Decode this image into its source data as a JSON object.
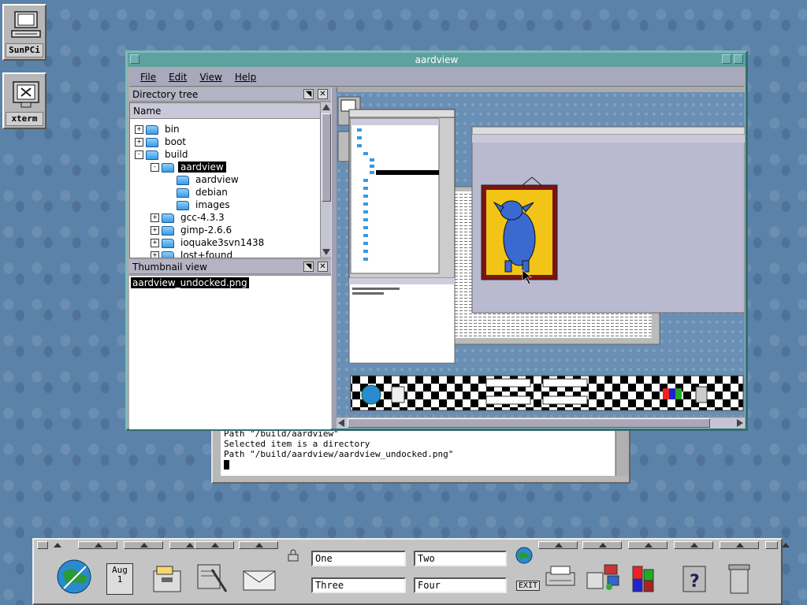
{
  "desktop": {
    "icons": [
      {
        "label": "SunPCi",
        "icon": "computer-icon"
      },
      {
        "label": "xterm",
        "icon": "terminal-icon"
      }
    ]
  },
  "xterm": {
    "lines": [
      "Path \"/build/aardview\"",
      "Selected item is a directory",
      "Path \"/build/aardview/aardview_undocked.png\""
    ]
  },
  "window": {
    "title": "aardview",
    "menu": [
      "File",
      "Edit",
      "View",
      "Help"
    ],
    "directory_panel": {
      "title": "Directory tree",
      "column": "Name",
      "rows": [
        {
          "label": "bin",
          "expander": "+",
          "depth": 0
        },
        {
          "label": "boot",
          "expander": "+",
          "depth": 0
        },
        {
          "label": "build",
          "expander": "-",
          "depth": 0
        },
        {
          "label": "aardview",
          "expander": "-",
          "depth": 1,
          "selected": true
        },
        {
          "label": "aardview",
          "expander": "",
          "depth": 2
        },
        {
          "label": "debian",
          "expander": "",
          "depth": 2
        },
        {
          "label": "images",
          "expander": "",
          "depth": 2
        },
        {
          "label": "gcc-4.3.3",
          "expander": "+",
          "depth": 1
        },
        {
          "label": "gimp-2.6.6",
          "expander": "+",
          "depth": 1
        },
        {
          "label": "ioquake3svn1438",
          "expander": "+",
          "depth": 1
        },
        {
          "label": "lost+found",
          "expander": "+",
          "depth": 1
        }
      ]
    },
    "thumbnail_panel": {
      "title": "Thumbnail view",
      "items": [
        "aardview_undocked.png"
      ]
    }
  },
  "front_panel": {
    "date": {
      "month": "Aug",
      "day": "1"
    },
    "workspaces": [
      "One",
      "Two",
      "Three",
      "Four"
    ],
    "exit_label": "EXIT",
    "colors": {
      "title": "#5fa0a0",
      "panel": "#c4c4c4",
      "desktop": "#5b82a8"
    }
  }
}
